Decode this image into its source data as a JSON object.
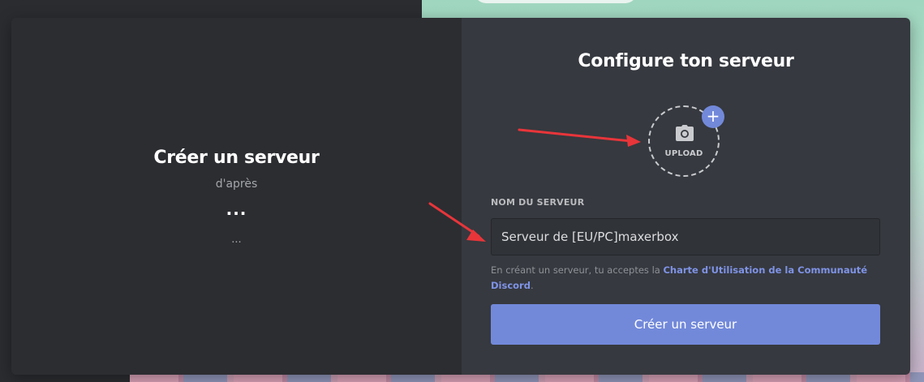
{
  "left_pane": {
    "title": "Créer un serveur",
    "subtitle": "d'après",
    "dots_bold": "...",
    "dots_small": "..."
  },
  "right_pane": {
    "title": "Configure ton serveur",
    "upload": {
      "label": "UPLOAD",
      "icon": "camera-icon",
      "plus_icon": "plus-icon",
      "plus_glyph": "+"
    },
    "server_name": {
      "label": "NOM DU SERVEUR",
      "value": "Serveur de [EU/PC]maxerbox"
    },
    "terms": {
      "prefix": "En créant un serveur, tu acceptes la ",
      "link": "Charte d'Utilisation de la Communauté Discord",
      "suffix": "."
    },
    "create_button": "Créer un serveur"
  },
  "annotations": {
    "arrow_icon": "red-arrow-icon",
    "color": "#e8353a"
  },
  "colors": {
    "accent": "#7289da",
    "link": "#7f93e6",
    "left_bg": "#2c2d31",
    "right_bg": "#36393f"
  }
}
